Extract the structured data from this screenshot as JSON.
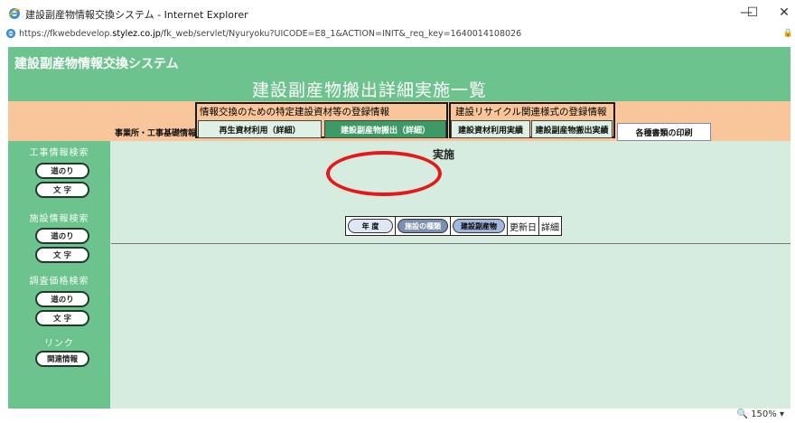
{
  "window": {
    "title": "建設副産物情報交換システム - Internet Explorer",
    "minimize": "—",
    "maximize": "☐",
    "close": "✕"
  },
  "address": {
    "url_prefix": "https://fkwebdevelop.",
    "url_domain": "stylez.co.jp",
    "url_path": "/fk_web/servlet/Nyuryoku?UICODE=E8_1&ACTION=INIT&_req_key=1640014108026"
  },
  "banner": {
    "system_title": "建設副産物情報交換システム",
    "page_title": "建設副産物搬出詳細実施一覧"
  },
  "groups": {
    "left_label": "情報交換のための特定建設資材等の登録情報",
    "right_label": "建設リサイクル関連様式の登録情報"
  },
  "tabs": {
    "office_basic": "事業所・工事基礎情報",
    "recycled_use": "再生資材利用（詳細）",
    "byproduct_out": "建設副産物搬出（詳細）",
    "material_actual": "建設資材利用実績",
    "byproduct_actual": "建設副産物搬出実績",
    "print": "各種書類の印刷"
  },
  "sidebar": {
    "sec1_label": "工事情報検索",
    "sec1_btn1": "道のり",
    "sec1_btn2": "文 字",
    "sec2_label": "施設情報検索",
    "sec2_btn1": "道のり",
    "sec2_btn2": "文 字",
    "sec3_label": "調査価格検索",
    "sec3_btn1": "道のり",
    "sec3_btn2": "文 字",
    "sec4_label": "リンク",
    "sec4_btn1": "関連情報"
  },
  "main": {
    "status_label": "実施",
    "cols": {
      "year": "年 度",
      "facility_type": "施設の種類",
      "byproduct": "建設副産物",
      "updated": "更新日",
      "detail": "詳細"
    }
  },
  "statusbar": {
    "zoom": "150%"
  },
  "colors": {
    "banner_green": "#6cc38d",
    "content_bg": "#d6ecdf",
    "orange": "#f9c59a",
    "highlight_red": "#e5191c"
  }
}
